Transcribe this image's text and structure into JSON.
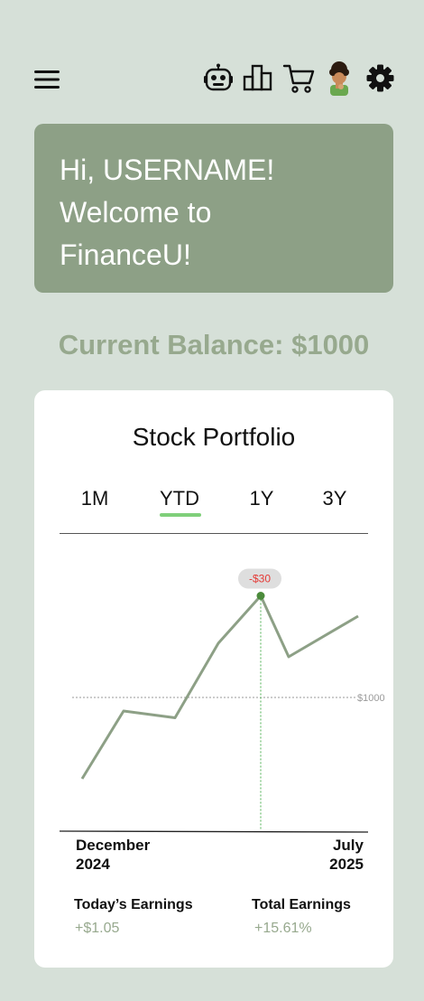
{
  "header": {
    "menu_icon": "hamburger-menu-icon",
    "icons": [
      "robot-icon",
      "bar-chart-icon",
      "shopping-cart-icon",
      "avatar",
      "gear-icon"
    ]
  },
  "welcome": {
    "line1": "Hi, USERNAME!",
    "line2": "Welcome to",
    "line3": "FinanceU!"
  },
  "balance": {
    "text": "Current Balance: $1000"
  },
  "portfolio": {
    "title": "Stock Portfolio",
    "tabs": [
      "1M",
      "YTD",
      "1Y",
      "3Y"
    ],
    "active_tab": "YTD",
    "x_start_label": "December\n2024",
    "x_end_label": "July\n2025",
    "reference_label": "$1000",
    "highlight_label": "-$30",
    "todays_earnings_label": "Today’s Earnings",
    "todays_earnings_value": "+$1.05",
    "total_earnings_label": "Total Earnings",
    "total_earnings_value": "+15.61%"
  },
  "colors": {
    "background": "#d6e0d8",
    "accent": "#8da086",
    "line": "#8da086",
    "tab_active": "#7fcf7a",
    "negative": "#e53935"
  },
  "chart_data": {
    "type": "line",
    "x": [
      "Dec 2024",
      "",
      "",
      "",
      "",
      "",
      "Jul 2025"
    ],
    "series": [
      {
        "values": [
          880,
          980,
          970,
          1080,
          1150,
          1060,
          1120
        ]
      }
    ],
    "reference_value": 1000,
    "highlight_index": 4,
    "highlight_text": "-$30",
    "ylim": [
      800,
      1200
    ]
  }
}
